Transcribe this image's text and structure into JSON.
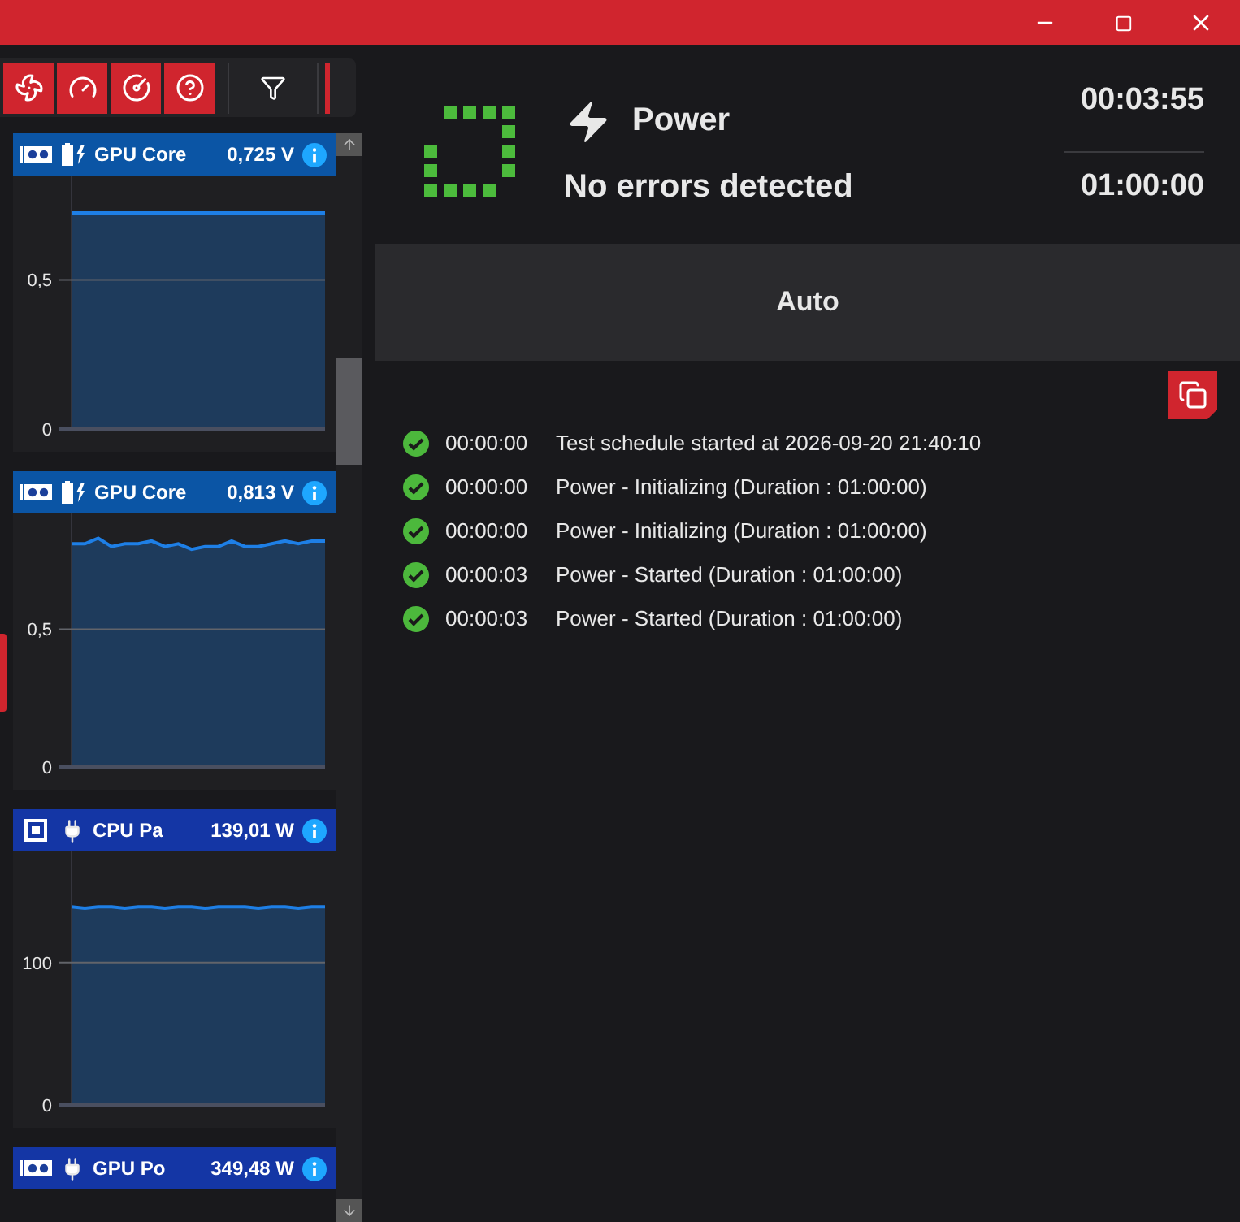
{
  "window": {
    "controls": [
      {
        "kind": "minimize"
      },
      {
        "kind": "maximize"
      },
      {
        "kind": "close"
      }
    ]
  },
  "toolbar": {
    "buttons": [
      {
        "kind": "fan"
      },
      {
        "kind": "gauge"
      },
      {
        "kind": "dial"
      },
      {
        "kind": "help"
      },
      {
        "kind": "filter"
      }
    ]
  },
  "sensors": [
    {
      "icons": [
        {
          "kind": "gpu"
        },
        {
          "kind": "voltage"
        }
      ],
      "name": "GPU Core",
      "value": "0,725 V",
      "chart_data": {
        "type": "area",
        "ylim": [
          0,
          0.85
        ],
        "yticks": [
          {
            "value": 0,
            "label": "0"
          },
          {
            "value": 0.5,
            "label": "0,5"
          }
        ],
        "series": [
          {
            "color": "#1e7fe6",
            "values": [
              0.725,
              0.725,
              0.725,
              0.725,
              0.725,
              0.725,
              0.725,
              0.725,
              0.725,
              0.725,
              0.725,
              0.725,
              0.725,
              0.725,
              0.725,
              0.725,
              0.725,
              0.725,
              0.725,
              0.725
            ]
          }
        ]
      }
    },
    {
      "icons": [
        {
          "kind": "gpu"
        },
        {
          "kind": "voltage"
        }
      ],
      "name": "GPU Core",
      "value": "0,813 V",
      "chart_data": {
        "type": "area",
        "ylim": [
          0,
          0.92
        ],
        "yticks": [
          {
            "value": 0,
            "label": "0"
          },
          {
            "value": 0.5,
            "label": "0,5"
          }
        ],
        "series": [
          {
            "color": "#1e7fe6",
            "values": [
              0.81,
              0.81,
              0.83,
              0.8,
              0.81,
              0.81,
              0.82,
              0.8,
              0.81,
              0.79,
              0.8,
              0.8,
              0.82,
              0.8,
              0.8,
              0.81,
              0.82,
              0.81,
              0.82,
              0.82
            ]
          }
        ]
      }
    },
    {
      "icons": [
        {
          "kind": "cpu"
        },
        {
          "kind": "power"
        }
      ],
      "name": "CPU Pa",
      "value": "139,01 W",
      "chart_data": {
        "type": "area",
        "ylim": [
          0,
          178
        ],
        "yticks": [
          {
            "value": 0,
            "label": "0"
          },
          {
            "value": 100,
            "label": "100"
          }
        ],
        "series": [
          {
            "color": "#1e7fe6",
            "values": [
              139,
              138,
              139,
              139,
              138,
              139,
              139,
              138,
              139,
              139,
              138,
              139,
              139,
              139,
              138,
              139,
              139,
              138,
              139,
              139
            ]
          }
        ]
      }
    },
    {
      "icons": [
        {
          "kind": "gpu"
        },
        {
          "kind": "power"
        }
      ],
      "name": "GPU Po",
      "value": "349,48 W"
    }
  ],
  "test": {
    "name": "Power",
    "status": "No errors detected",
    "elapsed": "00:03:55",
    "duration": "01:00:00",
    "mode": "Auto"
  },
  "log": [
    {
      "time": "00:00:00",
      "message": "Test schedule started at 2026-09-20 21:40:10"
    },
    {
      "time": "00:00:00",
      "message": "Power - Initializing (Duration : 01:00:00)"
    },
    {
      "time": "00:00:00",
      "message": "Power - Initializing (Duration : 01:00:00)"
    },
    {
      "time": "00:00:03",
      "message": "Power - Started (Duration : 01:00:00)"
    },
    {
      "time": "00:00:03",
      "message": "Power - Started (Duration : 01:00:00)"
    }
  ]
}
